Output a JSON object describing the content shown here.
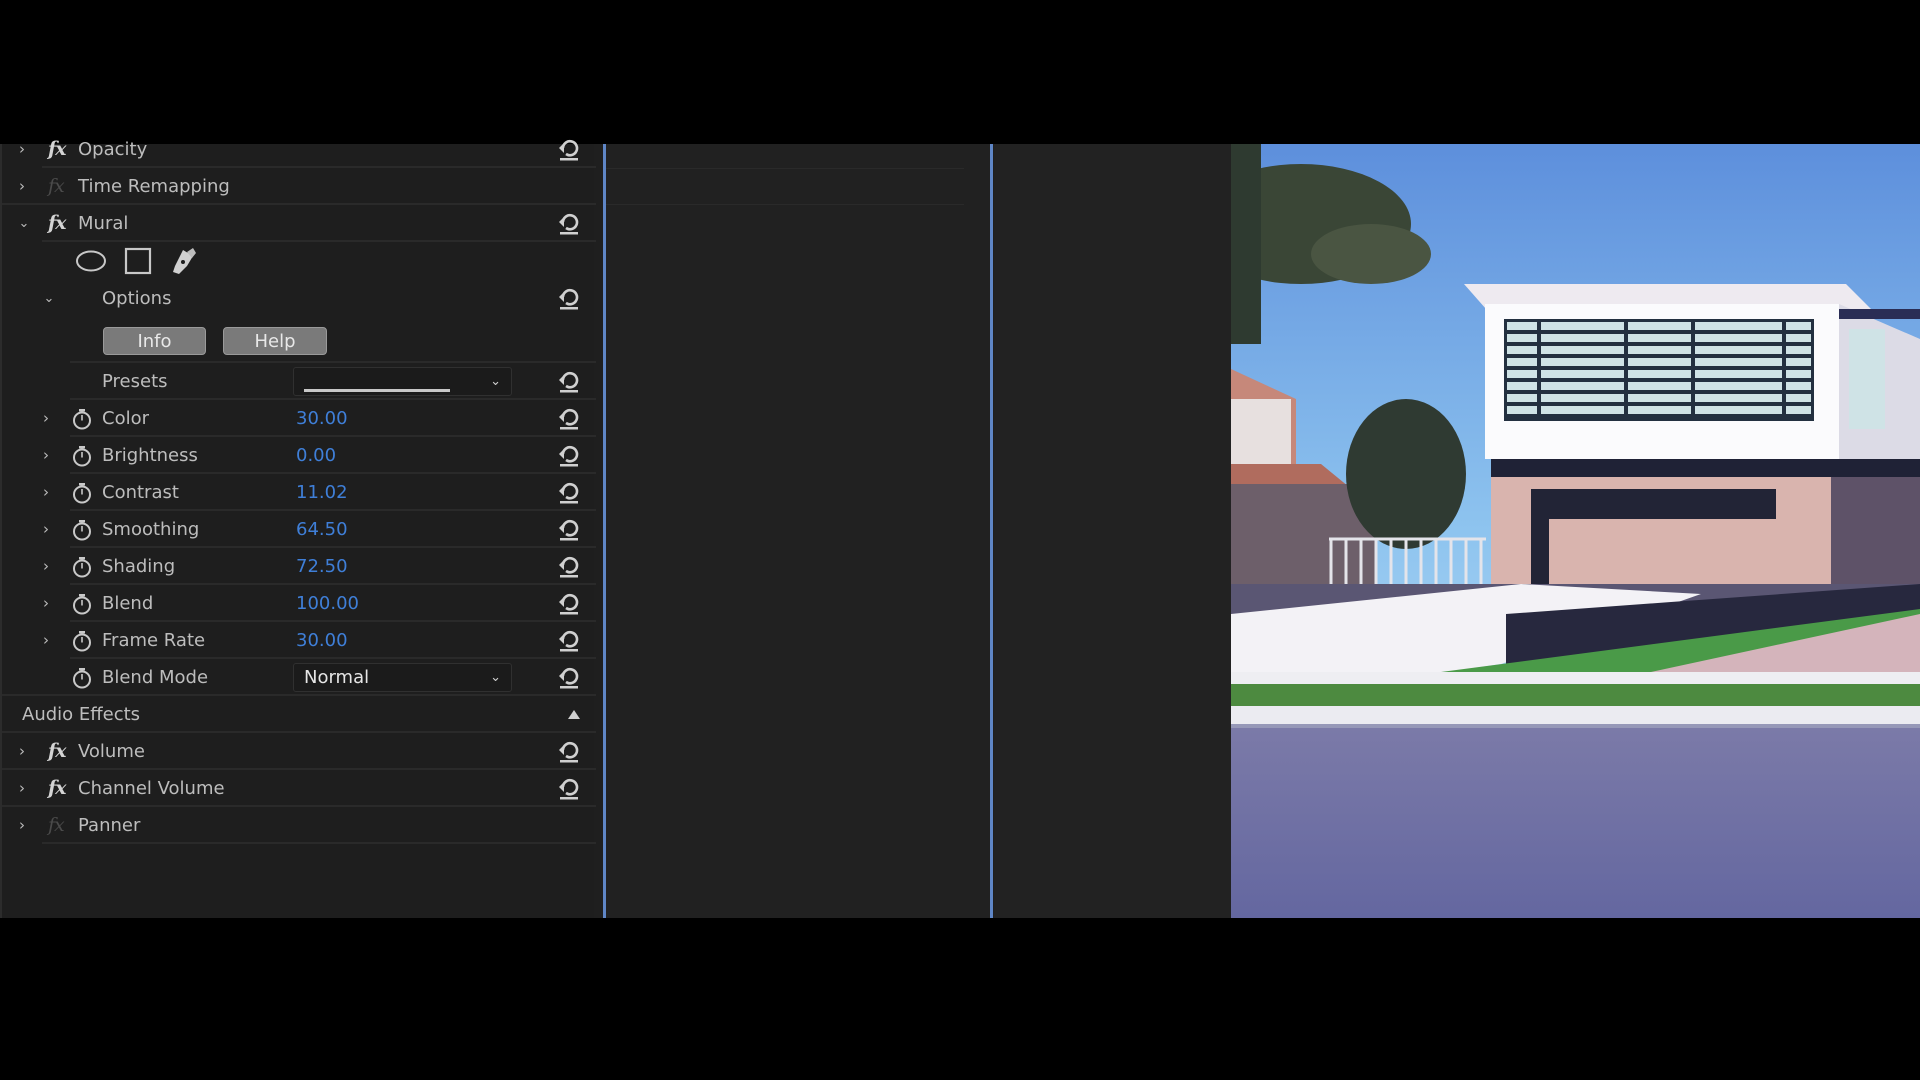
{
  "effect_controls": {
    "video_effects": [
      {
        "name": "Opacity",
        "fx_enabled": true,
        "expanded": false,
        "has_reset": true
      },
      {
        "name": "Time Remapping",
        "fx_enabled": false,
        "expanded": false,
        "has_reset": false
      },
      {
        "name": "Mural",
        "fx_enabled": true,
        "expanded": true,
        "has_reset": true
      }
    ],
    "mural": {
      "mask_tools": [
        "ellipse-mask-icon",
        "rectangle-mask-icon",
        "pen-mask-icon"
      ],
      "options_label": "Options",
      "buttons": {
        "info": "Info",
        "help": "Help"
      },
      "presets": {
        "label": "Presets",
        "value": ""
      },
      "params": [
        {
          "label": "Color",
          "value": "30.00"
        },
        {
          "label": "Brightness",
          "value": "0.00"
        },
        {
          "label": "Contrast",
          "value": "11.02"
        },
        {
          "label": "Smoothing",
          "value": "64.50"
        },
        {
          "label": "Shading",
          "value": "72.50"
        },
        {
          "label": "Blend",
          "value": "100.00"
        },
        {
          "label": "Frame Rate",
          "value": "30.00"
        }
      ],
      "blend_mode": {
        "label": "Blend Mode",
        "value": "Normal"
      }
    },
    "audio_section": {
      "label": "Audio Effects"
    },
    "audio_effects": [
      {
        "name": "Volume",
        "fx_enabled": true,
        "has_reset": true
      },
      {
        "name": "Channel Volume",
        "fx_enabled": true,
        "has_reset": true
      },
      {
        "name": "Panner",
        "fx_enabled": false,
        "has_reset": false
      }
    ]
  },
  "preview": {
    "description": "Program monitor showing a modern house with the Mural effect applied"
  },
  "colors": {
    "value_blue": "#3f7fd8",
    "playhead_blue": "#5f86c6",
    "panel_bg": "#1e1e1e"
  }
}
